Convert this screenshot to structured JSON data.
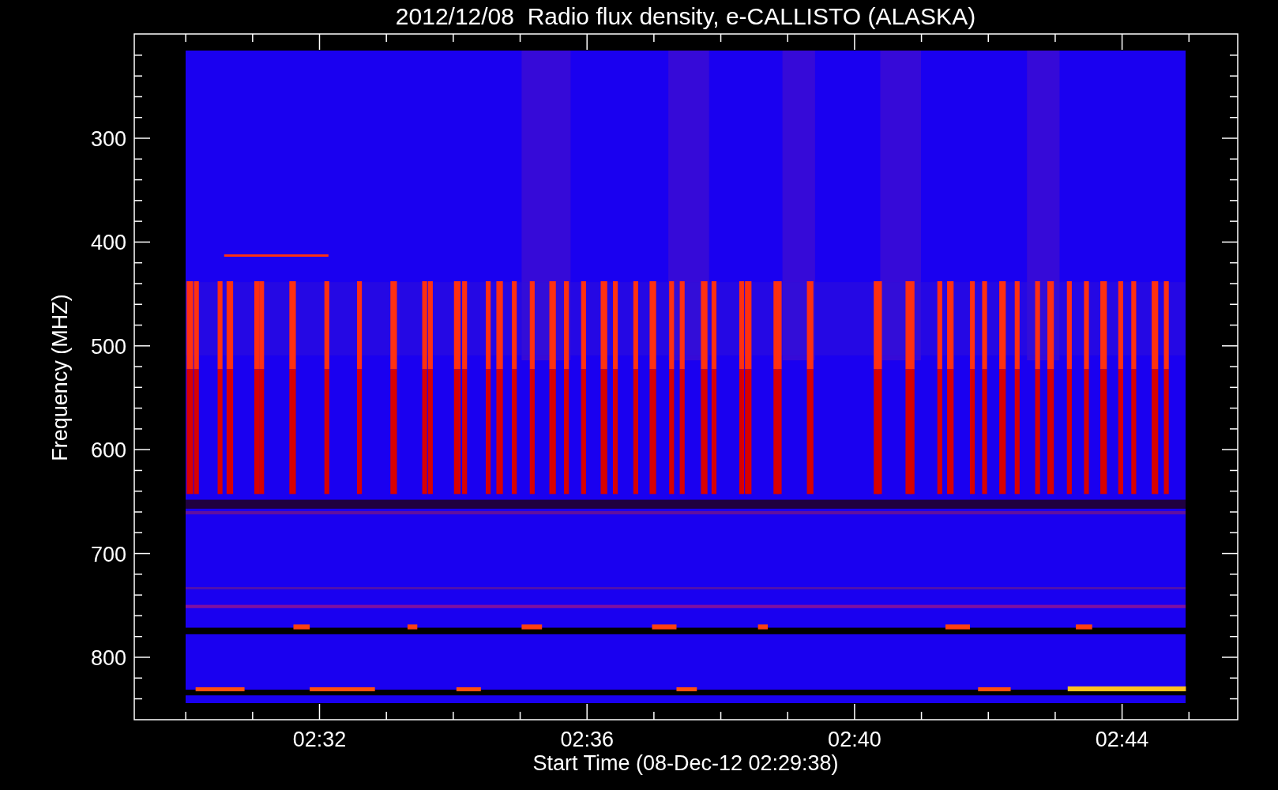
{
  "title": "2012/12/08  Radio flux density, e-CALLISTO (ALASKA)",
  "y_axis": {
    "label": "Frequency (MHZ)",
    "ticks": [
      "300",
      "400",
      "500",
      "600",
      "700",
      "800"
    ]
  },
  "x_axis": {
    "label": "Start Time (08-Dec-12 02:29:38)",
    "ticks": [
      "02:32",
      "02:36",
      "02:40",
      "02:44"
    ]
  }
}
